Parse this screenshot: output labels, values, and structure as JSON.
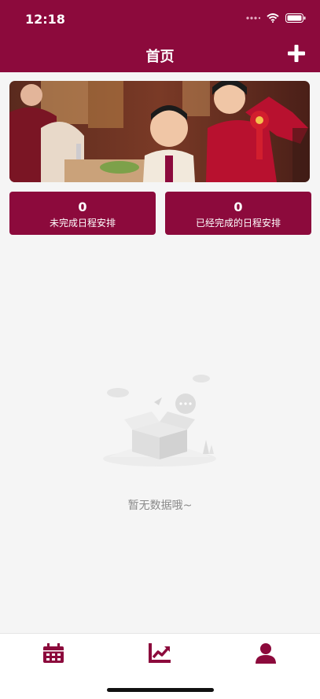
{
  "status_bar": {
    "time": "12:18"
  },
  "header": {
    "title": "首页",
    "add_icon": "plus-icon"
  },
  "stats": [
    {
      "count": "0",
      "label": "未完成日程安排"
    },
    {
      "count": "0",
      "label": "已经完成的日程安排"
    }
  ],
  "empty_state": {
    "message": "暂无数据哦~"
  },
  "tabbar": {
    "icons": [
      "calendar-icon",
      "chart-icon",
      "user-icon"
    ]
  },
  "colors": {
    "primary": "#8c0a3c",
    "background": "#f5f5f5"
  }
}
